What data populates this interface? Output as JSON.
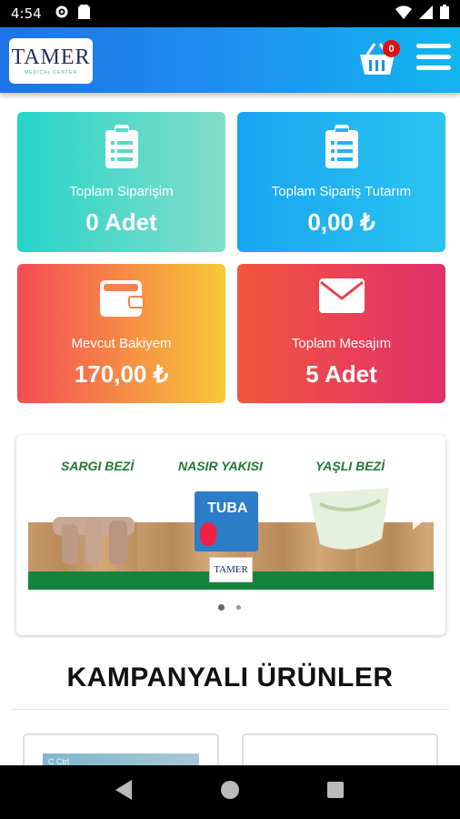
{
  "status_bar": {
    "time": "4:54"
  },
  "header": {
    "logo": {
      "brand": "TAMER",
      "subtitle": "MEDICAL CENTER"
    },
    "cart_count": "0"
  },
  "cards": [
    {
      "label": "Toplam Siparişim",
      "value": "0 Adet",
      "icon": "clipboard-icon"
    },
    {
      "label": "Toplam Sipariş Tutarım",
      "value": "0,00 ₺",
      "icon": "clipboard-icon"
    },
    {
      "label": "Mevcut Bakiyem",
      "value": "170,00 ₺",
      "icon": "wallet-icon"
    },
    {
      "label": "Toplam Mesajım",
      "value": "5 Adet",
      "icon": "envelope-icon"
    }
  ],
  "banner": {
    "titles": [
      "SARGI BEZİ",
      "NASIR YAKISI",
      "YAŞLI BEZİ"
    ],
    "product_label": "TUBA",
    "floor_logo": "TAMER",
    "slide_index": 1,
    "slide_count": 2
  },
  "campaign": {
    "title": "KAMPANYALI ÜRÜNLER"
  },
  "colors": {
    "appbar_start": "#1c74e6",
    "appbar_end": "#11b6ee",
    "badge": "#dd1111",
    "banner_green": "#1f7a2f"
  }
}
